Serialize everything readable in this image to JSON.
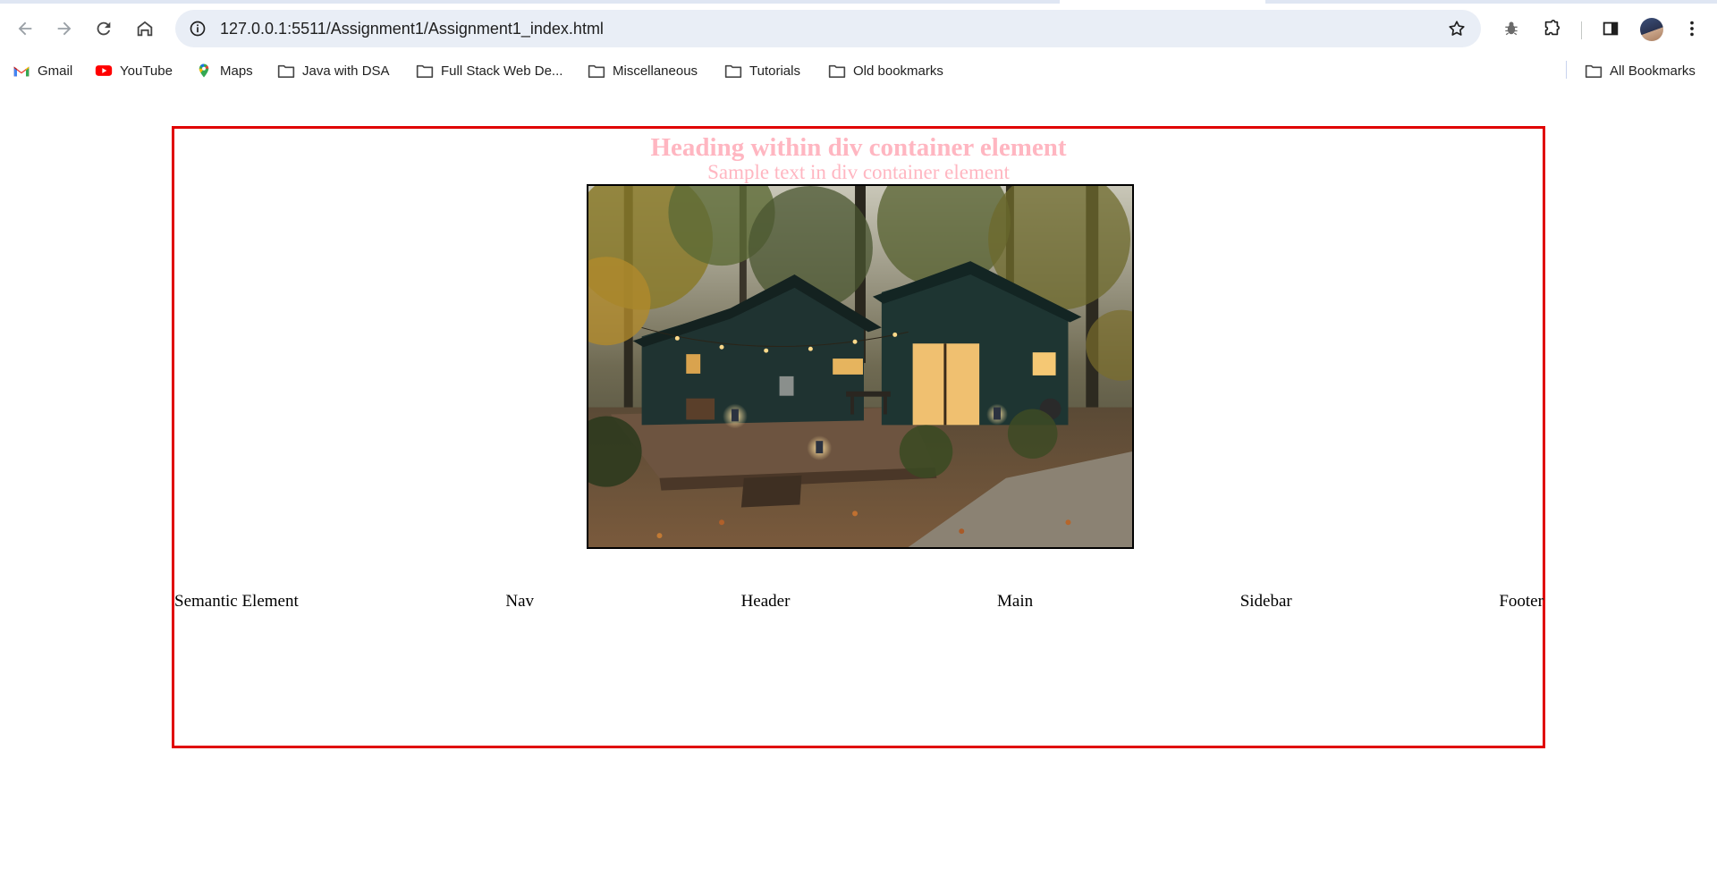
{
  "browser": {
    "url": "127.0.0.1:5511/Assignment1/Assignment1_index.html",
    "bookmarks": [
      {
        "label": "Gmail",
        "icon": "gmail-icon"
      },
      {
        "label": "YouTube",
        "icon": "youtube-icon"
      },
      {
        "label": "Maps",
        "icon": "maps-icon"
      },
      {
        "label": "Java with DSA",
        "icon": "folder-icon"
      },
      {
        "label": "Full Stack Web De...",
        "icon": "folder-icon"
      },
      {
        "label": "Miscellaneous",
        "icon": "folder-icon"
      },
      {
        "label": "Tutorials",
        "icon": "folder-icon"
      },
      {
        "label": "Old bookmarks",
        "icon": "folder-icon"
      }
    ],
    "all_bookmarks": "All Bookmarks"
  },
  "page": {
    "heading": "Heading within div container element",
    "subtext": "Sample text in div container element",
    "semantic_items": [
      "Semantic Element",
      "Nav",
      "Header",
      "Main",
      "Sidebar",
      "Footer"
    ],
    "colors": {
      "container_border": "#e00000",
      "heading_text": "#ffb6c1"
    }
  }
}
